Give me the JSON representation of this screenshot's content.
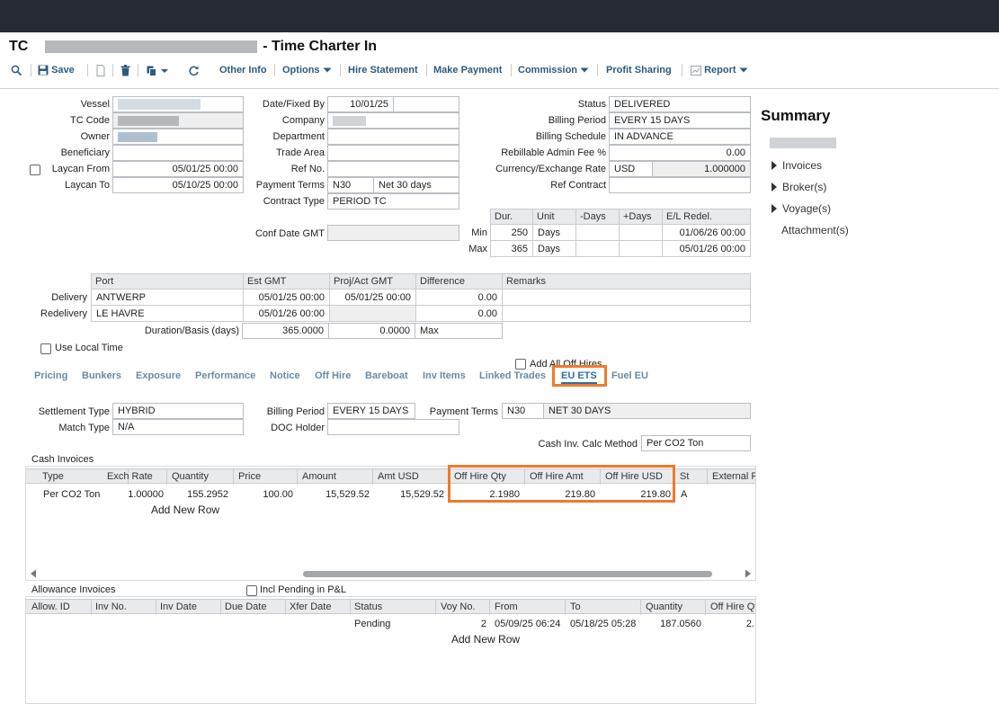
{
  "header": {
    "title_prefix": "TC",
    "title_suffix": "- Time Charter In"
  },
  "toolbar": {
    "save": "Save",
    "other_info": "Other Info",
    "options": "Options",
    "hire_statement": "Hire Statement",
    "make_payment": "Make Payment",
    "commission": "Commission",
    "profit_sharing": "Profit Sharing",
    "report": "Report"
  },
  "form_left": {
    "vessel_label": "Vessel",
    "tc_code_label": "TC Code",
    "owner_label": "Owner",
    "beneficiary_label": "Beneficiary",
    "laycan_from_label": "Laycan From",
    "laycan_from": "05/01/25 00:00",
    "laycan_to_label": "Laycan To",
    "laycan_to": "05/10/25 00:00"
  },
  "form_mid": {
    "date_fixed_by_label": "Date/Fixed By",
    "date_fixed": "10/01/25",
    "company_label": "Company",
    "department_label": "Department",
    "trade_area_label": "Trade Area",
    "ref_no_label": "Ref No.",
    "payment_terms_label": "Payment Terms",
    "payment_terms_code": "N30",
    "payment_terms_desc": "Net 30 days",
    "contract_type_label": "Contract Type",
    "contract_type": "PERIOD TC",
    "conf_date_label": "Conf Date GMT"
  },
  "form_right": {
    "status_label": "Status",
    "status": "DELIVERED",
    "billing_period_label": "Billing Period",
    "billing_period": "EVERY 15 DAYS",
    "billing_schedule_label": "Billing Schedule",
    "billing_schedule": "IN ADVANCE",
    "rebillable_label": "Rebillable Admin Fee %",
    "rebillable": "0.00",
    "currency_label": "Currency/Exchange Rate",
    "currency": "USD",
    "exchange_rate": "1.000000",
    "ref_contract_label": "Ref Contract"
  },
  "duration": {
    "headers": [
      "Dur.",
      "Unit",
      "-Days",
      "+Days",
      "E/L Redel."
    ],
    "min_label": "Min",
    "max_label": "Max",
    "min": {
      "dur": "250",
      "unit": "Days",
      "el": "01/06/26 00:00"
    },
    "max": {
      "dur": "365",
      "unit": "Days",
      "el": "05/01/26 00:00"
    }
  },
  "ports": {
    "headers": [
      "Port",
      "Est GMT",
      "Proj/Act GMT",
      "Difference",
      "Remarks"
    ],
    "delivery_label": "Delivery",
    "redelivery_label": "Redelivery",
    "delivery": {
      "port": "ANTWERP",
      "est": "05/01/25 00:00",
      "proj": "05/01/25 00:00",
      "diff": "0.00"
    },
    "redelivery": {
      "port": "LE HAVRE",
      "est": "05/01/26 00:00",
      "diff": "0.00"
    },
    "duration_label": "Duration/Basis (days)",
    "duration": "365.0000",
    "basis": "0.0000",
    "basis_type": "Max"
  },
  "use_local_time": "Use Local Time",
  "add_all_off_hires": "Add All Off Hires",
  "subtabs": [
    "Pricing",
    "Bunkers",
    "Exposure",
    "Performance",
    "Notice",
    "Off Hire",
    "Bareboat",
    "Inv Items",
    "Linked Trades",
    "EU ETS",
    "Fuel EU"
  ],
  "ets": {
    "settlement_type_label": "Settlement Type",
    "settlement_type": "HYBRID",
    "match_type_label": "Match Type",
    "match_type": "N/A",
    "billing_period_label": "Billing Period",
    "billing_period": "EVERY 15 DAYS",
    "payment_terms_label": "Payment Terms",
    "payment_terms_code": "N30",
    "payment_terms_desc": "NET 30 DAYS",
    "doc_holder_label": "DOC Holder",
    "calc_method_label": "Cash Inv. Calc Method",
    "calc_method": "Per CO2 Ton"
  },
  "cash_invoices": {
    "title": "Cash Invoices",
    "headers": [
      "Type",
      "Exch Rate",
      "Quantity",
      "Price",
      "Amount",
      "Amt USD",
      "Off Hire Qty",
      "Off Hire Amt",
      "Off Hire USD",
      "St",
      "External R"
    ],
    "row": [
      "Per CO2 Ton",
      "1.00000",
      "155.2952",
      "100.00",
      "15,529.52",
      "15,529.52",
      "2.1980",
      "219.80",
      "219.80",
      "A"
    ],
    "add_row": "Add New Row"
  },
  "allowance_invoices": {
    "title": "Allowance Invoices",
    "incl_pending": "Incl Pending in P&L",
    "headers": [
      "Allow. ID",
      "Inv No.",
      "Inv Date",
      "Due Date",
      "Xfer Date",
      "Status",
      "Voy No.",
      "From",
      "To",
      "Quantity",
      "Off Hire Qt"
    ],
    "row": {
      "status": "Pending",
      "voy": "2",
      "from": "05/09/25 06:24",
      "to": "05/18/25 05:28",
      "qty": "187.0560",
      "offhire": "2."
    },
    "add_row": "Add New Row"
  },
  "summary": {
    "title": "Summary",
    "invoices": "Invoices",
    "brokers": "Broker(s)",
    "voyages": "Voyage(s)",
    "attachments": "Attachment(s)"
  },
  "colors": {
    "highlight": "#ef7a2a",
    "link": "#2e6fa8",
    "topbar": "#262b33"
  }
}
